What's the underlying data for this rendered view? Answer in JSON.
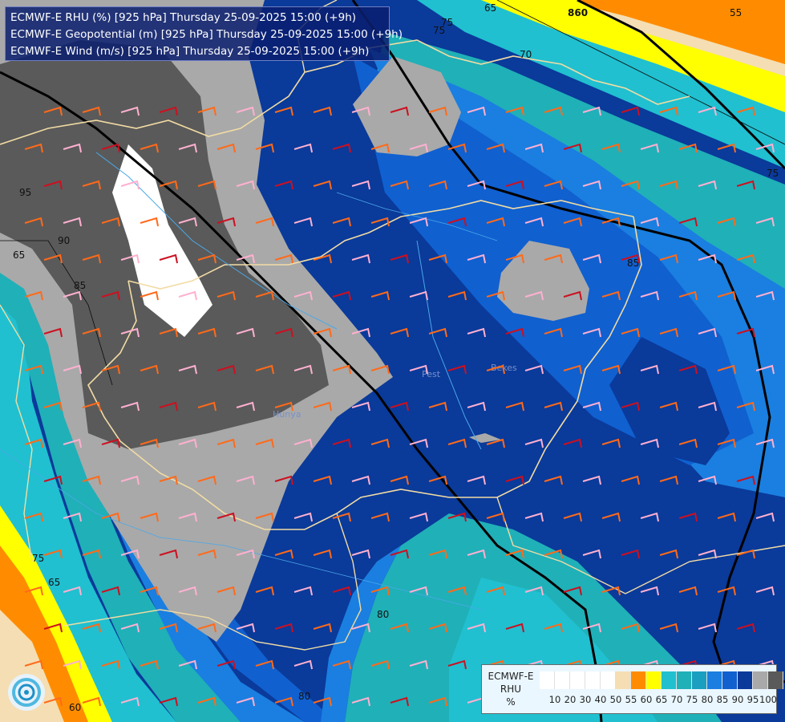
{
  "header": {
    "line1": "ECMWF-E RHU (%) [925 hPa] Thursday 25-09-2025 15:00 (+9h)",
    "line2": "ECMWF-E Geopotential (m) [925 hPa] Thursday 25-09-2025 15:00 (+9h)",
    "line3": "ECMWF-E Wind (m/s) [925 hPa] Thursday 25-09-2025 15:00 (+9h)"
  },
  "legend": {
    "model": "ECMWF-E",
    "variable": "RHU",
    "unit": "%",
    "ticks": [
      "10",
      "20",
      "30",
      "40",
      "50",
      "55",
      "60",
      "65",
      "70",
      "75",
      "80",
      "85",
      "90",
      "95",
      "100"
    ],
    "colors": [
      "#ffffff",
      "#ffffff",
      "#ffffff",
      "#ffffff",
      "#ffffff",
      "#f5deb3",
      "#ff8c00",
      "#ffff00",
      "#20c0d0",
      "#20b0b8",
      "#1a9fc0",
      "#1a7fe0",
      "#1060d0",
      "#0a3a9a",
      "#a9a9a9",
      "#5a5a5a"
    ]
  },
  "map": {
    "contour_labels": [
      "65",
      "75",
      "860",
      "55",
      "70",
      "75",
      "95",
      "65",
      "90",
      "85",
      "85",
      "75",
      "65",
      "60",
      "80",
      "75",
      "80"
    ],
    "places": [
      "Pest",
      "Bekes",
      "Hunya"
    ]
  }
}
